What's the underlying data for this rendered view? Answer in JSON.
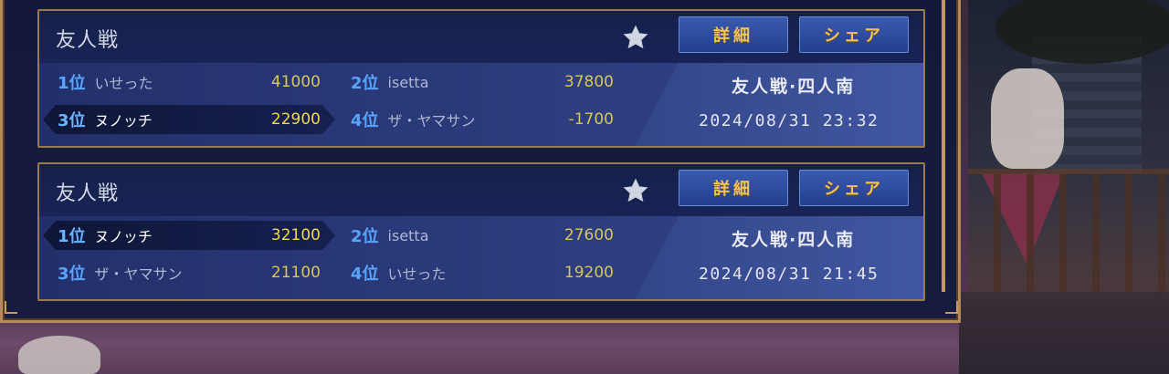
{
  "matches": [
    {
      "title": "友人戦",
      "buttons": {
        "detail": "詳細",
        "share": "シェア"
      },
      "mode": "友人戦·四人南",
      "datetime": "2024/08/31 23:32",
      "players": [
        {
          "rank": "1位",
          "name": "いせった",
          "score": "41000"
        },
        {
          "rank": "2位",
          "name": "isetta",
          "score": "37800"
        },
        {
          "rank": "3位",
          "name": "ヌノッチ",
          "score": "22900"
        },
        {
          "rank": "4位",
          "name": "ザ・ヤマサン",
          "score": "-1700"
        }
      ]
    },
    {
      "title": "友人戦",
      "buttons": {
        "detail": "詳細",
        "share": "シェア"
      },
      "mode": "友人戦·四人南",
      "datetime": "2024/08/31 21:45",
      "players": [
        {
          "rank": "1位",
          "name": "ヌノッチ",
          "score": "32100"
        },
        {
          "rank": "2位",
          "name": "isetta",
          "score": "27600"
        },
        {
          "rank": "3位",
          "name": "ザ・ヤマサン",
          "score": "21100"
        },
        {
          "rank": "4位",
          "name": "いせった",
          "score": "19200"
        }
      ]
    }
  ],
  "colors": {
    "accent_gold": "#f2c35a",
    "rank_blue": "#5aa4ff",
    "score_yellow": "#d7c65a",
    "frame": "#b48a5a"
  },
  "icons": {
    "favorite": "star-icon"
  }
}
